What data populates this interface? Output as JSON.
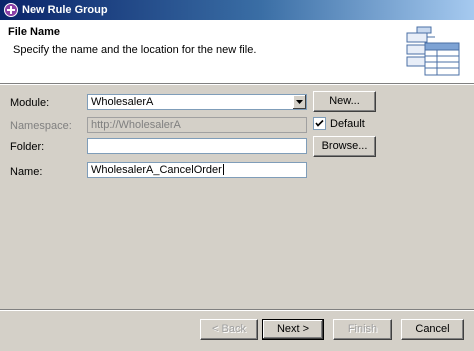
{
  "window": {
    "title": "New Rule Group",
    "icon": "rule-group-icon"
  },
  "header": {
    "title": "File Name",
    "description": "Specify the name and the location for the new file.",
    "graphic": "wizard-table-graphic-icon"
  },
  "form": {
    "module": {
      "label": "Module:",
      "value": "WholesalerA",
      "button": "New..."
    },
    "namespace": {
      "label": "Namespace:",
      "value": "http://WholesalerA",
      "default_label": "Default",
      "default_checked": true
    },
    "folder": {
      "label": "Folder:",
      "value": "",
      "button": "Browse..."
    },
    "name": {
      "label": "Name:",
      "value": "WholesalerA_CancelOrder"
    }
  },
  "buttons": {
    "back": "< Back",
    "next": "Next >",
    "finish": "Finish",
    "cancel": "Cancel"
  },
  "colors": {
    "titlebar_start": "#0a246a",
    "titlebar_end": "#a6caf0",
    "dialog_bg": "#d4d0c8"
  }
}
